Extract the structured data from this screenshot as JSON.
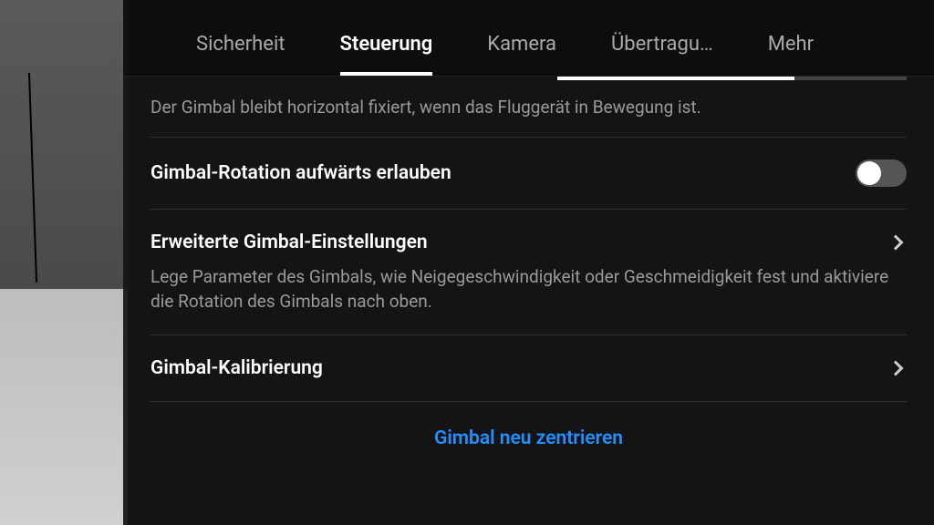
{
  "tabs": {
    "items": [
      {
        "label": "Sicherheit",
        "active": false
      },
      {
        "label": "Steuerung",
        "active": true
      },
      {
        "label": "Kamera",
        "active": false
      },
      {
        "label": "Übertragu…",
        "active": false
      },
      {
        "label": "Mehr",
        "active": false
      }
    ]
  },
  "gimbal_fixed_desc": "Der Gimbal bleibt horizontal fixiert, wenn das Fluggerät in Bewegung ist.",
  "allow_up_rotation": {
    "label": "Gimbal-Rotation aufwärts erlauben",
    "enabled": false
  },
  "advanced_settings": {
    "label": "Erweiterte Gimbal-Einstellungen",
    "desc": "Lege Parameter des Gimbals, wie Neigegeschwindigkeit oder Geschmeidigkeit fest und aktiviere die Rotation des Gimbals nach oben."
  },
  "calibration": {
    "label": "Gimbal-Kalibrierung"
  },
  "recenter": {
    "label": "Gimbal neu zentrieren"
  }
}
